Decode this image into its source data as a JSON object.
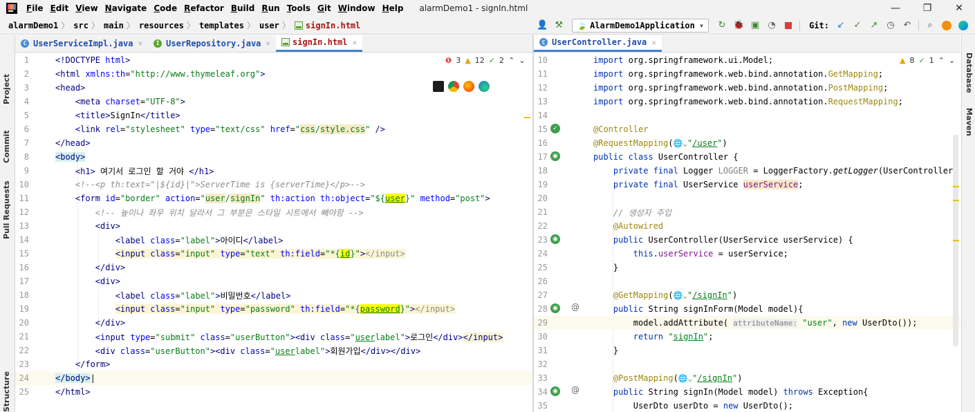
{
  "window": {
    "title": "alarmDemo1 - signIn.html",
    "menu": [
      {
        "u": "F",
        "rest": "ile"
      },
      {
        "u": "E",
        "rest": "dit"
      },
      {
        "u": "V",
        "rest": "iew"
      },
      {
        "u": "N",
        "rest": "avigate"
      },
      {
        "u": "C",
        "rest": "ode"
      },
      {
        "u": "R",
        "rest": "efactor"
      },
      {
        "u": "B",
        "rest": "uild"
      },
      {
        "u": "R",
        "rest": "un",
        "pre": ""
      },
      {
        "u": "T",
        "rest": "ools"
      },
      {
        "u": "G",
        "rest": "it"
      },
      {
        "u": "W",
        "rest": "indow"
      },
      {
        "u": "H",
        "rest": "elp"
      }
    ],
    "minimize": "—",
    "maximize": "❐",
    "close": "✕"
  },
  "breadcrumb": [
    "alarmDemo1",
    "src",
    "main",
    "resources",
    "templates",
    "user",
    "signIn.html"
  ],
  "toolbar": {
    "run_config": "AlarmDemo1Application",
    "git_label": "Git:"
  },
  "left_strip": [
    "Project",
    "Commit",
    "Pull Requests",
    "Structure"
  ],
  "right_strip": [
    "Database",
    "Maven"
  ],
  "left_tabs": [
    {
      "label": "UserServiceImpl.java",
      "icon": "class-icon"
    },
    {
      "label": "UserRepository.java",
      "icon": "interface-icon"
    },
    {
      "label": "signIn.html",
      "icon": "html-icon",
      "active": true
    }
  ],
  "right_tabs": [
    {
      "label": "UserController.java",
      "icon": "class-icon",
      "active": true
    }
  ],
  "left_inspect": {
    "errors": "3",
    "warnings": "12",
    "typos": "2"
  },
  "right_inspect": {
    "warnings": "8",
    "typos": "1"
  },
  "left_code": [
    {
      "n": "1",
      "h": "<span class='tag'>&lt;!DOCTYPE </span><span class='attr'>html</span><span class='tag'>&gt;</span>"
    },
    {
      "n": "2",
      "h": "<span class='tag'>&lt;html </span><span class='attr'>xmlns:th</span>=<span class='str'>\"http://www.thymeleaf.org\"</span><span class='tag'>&gt;</span>"
    },
    {
      "n": "3",
      "h": "<span class='tag'>&lt;head&gt;</span>"
    },
    {
      "n": "4",
      "h": "    <span class='tag'>&lt;meta </span><span class='attr'>charset</span>=<span class='str'>\"UTF-8\"</span><span class='tag'>&gt;</span>"
    },
    {
      "n": "5",
      "h": "    <span class='tag'>&lt;title&gt;</span>SignIn<span class='tag'>&lt;/title&gt;</span>"
    },
    {
      "n": "6",
      "h": "    <span class='tag'>&lt;link </span><span class='attr'>rel</span>=<span class='str'>\"stylesheet\"</span> <span class='attr'>type</span>=<span class='str'>\"text/css\"</span> <span class='attr'>href</span>=<span class='str'>\"<span class='field-hl'>css</span>/<span class='field-hl'>style.css</span>\"</span> <span class='tag'>/&gt;</span>"
    },
    {
      "n": "7",
      "h": "<span class='tag'>&lt;/head&gt;</span>"
    },
    {
      "n": "8",
      "h": "<span class='tag' style='background:#d4f0f0'>&lt;body&gt;</span>"
    },
    {
      "n": "9",
      "h": "    <span class='tag'>&lt;h1&gt;</span> 여기서 로그인 할 거야 <span class='tag'>&lt;/h1&gt;</span>"
    },
    {
      "n": "10",
      "h": "    <span class='cmt'>&lt;!--&lt;p th:text=\"|${id}|\"&gt;ServerTime is {serverTime}&lt;/p&gt;--&gt;</span>"
    },
    {
      "n": "11",
      "h": "    <span class='tag'>&lt;form </span><span class='attr'>id</span>=<span class='str'>\"border\"</span> <span class='attr'>action</span>=<span class='str'>\"<span class='field-hl'>user</span>/<span class='field-hl'>signIn</span>\"</span> <span class='attr'>th:action</span> <span class='attr'>th:object</span>=<span class='str'>\"${<span class='pre-hl'>user</span>}\"</span> <span class='attr'>method</span>=<span class='str'>\"post\"</span><span class='tag'>&gt;</span>"
    },
    {
      "n": "12",
      "h": "        <span class='cmt'>&lt;!-- 높이나 좌우 위치 달라서 그 부분은 스타일 시트에서 빼야함 --&gt;</span>"
    },
    {
      "n": "13",
      "h": "        <span class='tag'>&lt;div&gt;</span>"
    },
    {
      "n": "14",
      "h": "            <span class='tag'>&lt;label </span><span class='attr'>class</span>=<span class='str'>\"label\"</span><span class='tag'>&gt;</span>아이디<span class='tag'>&lt;/label&gt;</span>"
    },
    {
      "n": "15",
      "h": "            <span class='hl-bg'><span class='tag'>&lt;input </span><span class='attr'>class</span>=<span class='str'>\"input\"</span> <span class='attr'>type</span>=<span class='str'>\"text\"</span> <span class='attr'>th:field</span>=<span class='str'>\"*{<span class='pre-hl'>id</span>}\"</span><span class='tag'>&gt;</span><span class='cmt' style='font-style:normal'>&lt;/input&gt;</span></span>"
    },
    {
      "n": "16",
      "h": "        <span class='tag'>&lt;/div&gt;</span>"
    },
    {
      "n": "17",
      "h": "        <span class='tag'>&lt;div&gt;</span>"
    },
    {
      "n": "18",
      "h": "            <span class='tag'>&lt;label </span><span class='attr'>class</span>=<span class='str'>\"label\"</span><span class='tag'>&gt;</span>비밀번호<span class='tag'>&lt;/label&gt;</span>"
    },
    {
      "n": "19",
      "h": "            <span class='hl-bg'><span class='tag'>&lt;input </span><span class='attr'>class</span>=<span class='str'>\"input\"</span> <span class='attr'>type</span>=<span class='str'>\"password\"</span> <span class='attr'>th:field</span>=<span class='str'>\"*{<span class='pre-hl'>password</span>}\"</span><span class='tag'>&gt;</span><span class='cmt' style='font-style:normal'>&lt;/input&gt;</span></span>"
    },
    {
      "n": "20",
      "h": "        <span class='tag'>&lt;/div&gt;</span>"
    },
    {
      "n": "21",
      "h": "        <span class='tag'>&lt;input </span><span class='attr'>type</span>=<span class='str'>\"submit\"</span> <span class='attr'>class</span>=<span class='str'>\"userButton\"</span><span class='tag'>&gt;&lt;div </span><span class='attr'>class</span>=<span class='str'>\"<span class='link'>user</span>label\"</span><span class='tag'>&gt;</span>로그인<span class='tag'>&lt;/div&gt;</span><span class='hl-bg'><span class='tag'>&lt;/input&gt;</span></span>"
    },
    {
      "n": "22",
      "h": "        <span class='tag'>&lt;div </span><span class='attr'>class</span>=<span class='str'>\"userButton\"</span><span class='tag'>&gt;&lt;div </span><span class='attr'>class</span>=<span class='str'>\"<span class='link'>user</span>label\"</span><span class='tag'>&gt;</span>회원가입<span class='tag'>&lt;/div&gt;&lt;/div&gt;</span>"
    },
    {
      "n": "23",
      "h": "    <span class='tag'>&lt;/form&gt;</span>"
    },
    {
      "n": "24",
      "h": "<span class='tag' style='background:#d4f0f0'>&lt;/body&gt;</span>|",
      "cur": true
    },
    {
      "n": "25",
      "h": "<span class='tag'>&lt;/html&gt;</span>"
    }
  ],
  "right_code": [
    {
      "n": "10",
      "h": "<span class='kw'>import</span> org.springframework.ui.Model;"
    },
    {
      "n": "11",
      "h": "<span class='kw'>import</span> org.springframework.web.bind.annotation.<span class='ann'>GetMapping</span>;"
    },
    {
      "n": "12",
      "h": "<span class='kw'>import</span> org.springframework.web.bind.annotation.<span class='ann'>PostMapping</span>;"
    },
    {
      "n": "13",
      "h": "<span class='kw'>import</span> org.springframework.web.bind.annotation.<span class='ann'>RequestMapping</span>;"
    },
    {
      "n": "14",
      "h": ""
    },
    {
      "n": "15",
      "h": "<span class='ann'>@Controller</span>"
    },
    {
      "n": "16",
      "h": "<span class='ann'>@RequestMapping</span>(<span class='param'>🌐⌄</span><span class='str'>\"<span class='link'>/user</span>\"</span>)"
    },
    {
      "n": "17",
      "h": "<span class='kw'>public class</span> UserController {"
    },
    {
      "n": "18",
      "h": "    <span class='kw'>private final</span> Logger <span class='fld' style='color:#808080'>LOGGER</span> = LoggerFactory.<span class='italic'>getLogger</span>(UserController."
    },
    {
      "n": "19",
      "h": "    <span class='kw'>private final</span> UserService <span class='fld field-hl'>userService</span>;"
    },
    {
      "n": "20",
      "h": ""
    },
    {
      "n": "21",
      "h": "    <span class='cmt'>// 생성자 주입</span>"
    },
    {
      "n": "22",
      "h": "    <span class='ann'>@Autowired</span>"
    },
    {
      "n": "23",
      "h": "    <span class='kw'>public</span> UserController(UserService userService) {"
    },
    {
      "n": "24",
      "h": "        <span class='kw'>this</span>.<span class='fld'>userService</span> = userService;"
    },
    {
      "n": "25",
      "h": "    }"
    },
    {
      "n": "26",
      "h": ""
    },
    {
      "n": "27",
      "h": "    <span class='ann'>@GetMapping</span>(<span class='param'>🌐⌄</span><span class='str'>\"<span class='link'>/signIn</span>\"</span>)"
    },
    {
      "n": "28",
      "h": "    <span class='kw'>public</span> String signInForm(Model model){"
    },
    {
      "n": "29",
      "h": "        model.addAttribute( <span class='param' style='background:#f0f0f0'>attributeName:</span> <span class='str'>\"user\"</span>, <span class='kw'>new</span> UserDto());",
      "cur": true
    },
    {
      "n": "30",
      "h": "        <span class='kw'>return</span> <span class='str'>\"<span class='link'>signIn</span>\"</span>;"
    },
    {
      "n": "31",
      "h": "    }"
    },
    {
      "n": "32",
      "h": ""
    },
    {
      "n": "33",
      "h": "    <span class='ann'>@PostMapping</span>(<span class='param'>🌐⌄</span><span class='str'>\"<span class='link'>/signIn</span>\"</span>)"
    },
    {
      "n": "34",
      "h": "    <span class='kw'>public</span> String signIn(Model model) <span class='kw'>throws</span> Exception{"
    },
    {
      "n": "35",
      "h": "        UserDto userDto = <span class='kw'>new</span> UserDto();"
    }
  ]
}
